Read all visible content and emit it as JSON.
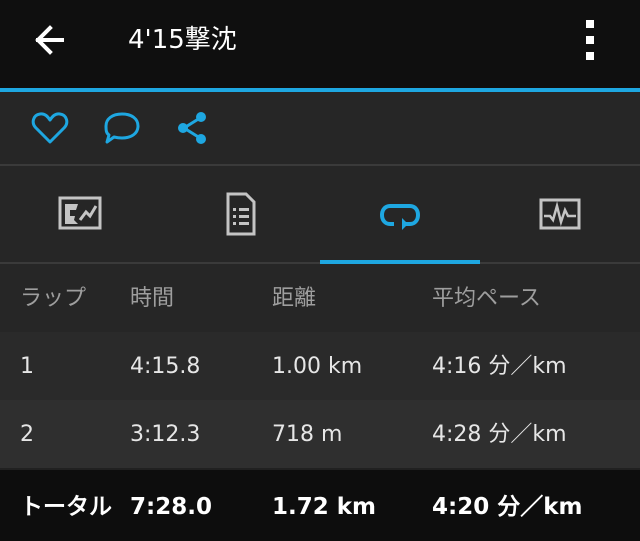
{
  "header": {
    "title": "4'15撃沈"
  },
  "icons": {
    "back": "arrow-left-icon",
    "more": "more-vert-icon",
    "like": "heart-icon",
    "comment": "comment-icon",
    "share": "share-icon"
  },
  "tabs": [
    {
      "icon": "map-chart-icon"
    },
    {
      "icon": "document-list-icon"
    },
    {
      "icon": "laps-icon",
      "selected": true
    },
    {
      "icon": "activity-graph-icon"
    }
  ],
  "colors": {
    "accent": "#1ea7e1",
    "background": "#212121",
    "topbar": "#0f0f0f"
  },
  "laps_table": {
    "headers": [
      "ラップ",
      "時間",
      "距離",
      "平均ペース"
    ],
    "rows": [
      [
        "1",
        "4:15.8",
        "1.00 km",
        "4:16 分／km"
      ],
      [
        "2",
        "3:12.3",
        "718 m",
        "4:28 分／km"
      ]
    ],
    "total": [
      "トータル",
      "7:28.0",
      "1.72 km",
      "4:20 分／km"
    ]
  }
}
